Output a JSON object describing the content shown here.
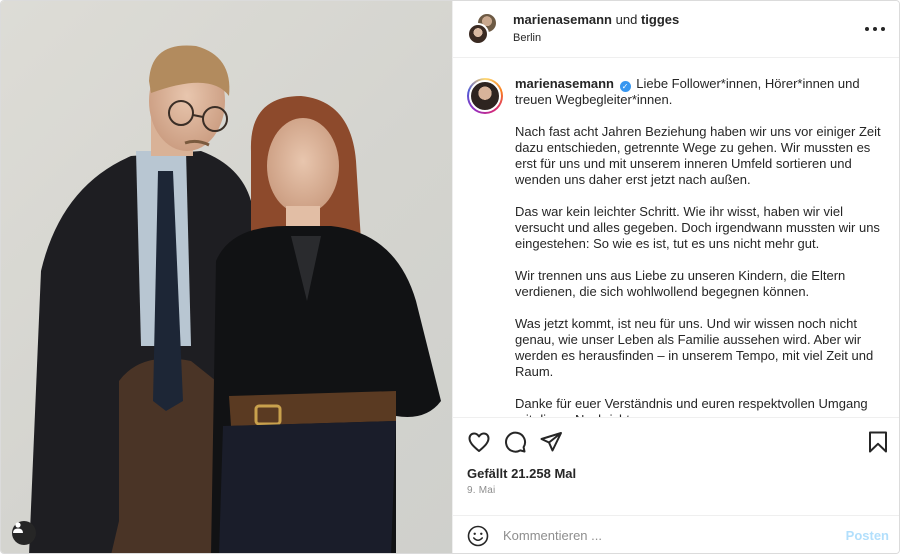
{
  "header": {
    "username": "marienasemann",
    "connector": "und",
    "collaborator": "tigges",
    "location": "Berlin"
  },
  "caption": {
    "username": "marienasemann",
    "verified": true,
    "intro": "Liebe Follower*innen, Hörer*innen und treuen Wegbegleiter*innen.",
    "paragraphs": [
      "Nach fast acht Jahren Beziehung haben wir uns vor einiger Zeit dazu entschieden, getrennte Wege zu gehen. Wir mussten es erst für uns und mit unserem inneren Umfeld sortieren und wenden uns daher erst jetzt nach außen.",
      "Das war kein leichter Schritt. Wie ihr wisst, haben wir viel versucht und alles gegeben. Doch irgendwann mussten wir uns eingestehen: So wie es ist, tut es uns nicht mehr gut.",
      "Wir trennen uns aus Liebe zu unseren Kindern, die Eltern verdienen, die sich wohlwollend begegnen können.",
      "Was jetzt kommt, ist neu für uns. Und wir wissen noch nicht genau, wie unser Leben als Familie aussehen wird. Aber wir werden es herausfinden – in unserem Tempo, mit viel Zeit und Raum.",
      "Danke für euer Verständnis und euren respektvollen Umgang mit dieser Nachricht."
    ]
  },
  "actions": {
    "icons": [
      "heart-icon",
      "comment-icon",
      "share-icon",
      "bookmark-icon"
    ]
  },
  "likes": "Gefällt 21.258 Mal",
  "date": "9. Mai",
  "comment": {
    "placeholder": "Kommentieren ...",
    "post_label": "Posten"
  },
  "colors": {
    "text": "#262626",
    "muted": "#8e8e8e",
    "border": "#efefef",
    "post_button_disabled": "#b2dffc",
    "verified_badge": "#3897f0"
  }
}
